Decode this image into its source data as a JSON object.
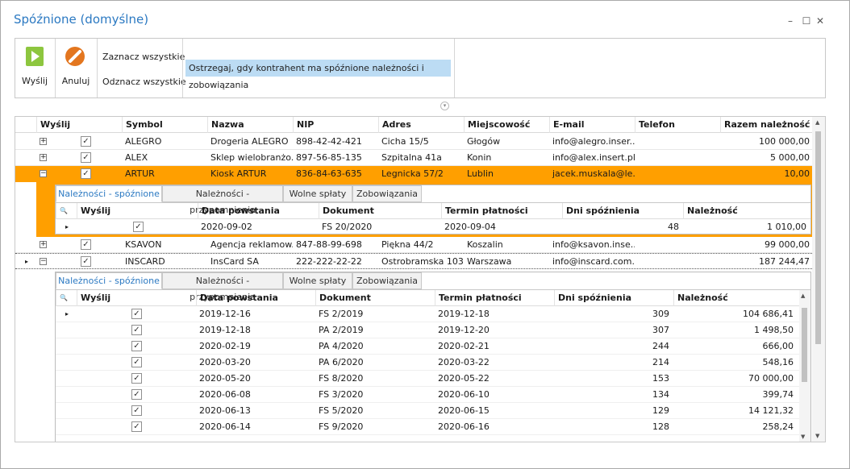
{
  "window": {
    "title": "Spóźnione (domyślne)",
    "min_glyph": "–",
    "max_glyph": "☐",
    "close_glyph": "✕"
  },
  "toolbar": {
    "send_label": "Wyślij",
    "cancel_label": "Anuluj",
    "select_all": "Zaznacz wszystkie",
    "deselect_all": "Odznacz wszystkie",
    "warn_option": "Ostrzegaj, gdy kontrahent ma spóźnione należności i zobowiązania"
  },
  "grid": {
    "columns": [
      "Wyślij",
      "Symbol",
      "Nazwa",
      "NIP",
      "Adres",
      "Miejscowość",
      "E-mail",
      "Telefon",
      "Razem należność"
    ],
    "rows": [
      {
        "symbol": "ALEGRO",
        "nazwa": "Drogeria ALEGRO",
        "nip": "898-42-42-421",
        "adres": "Cicha  15/5",
        "miejscowosc": "Głogów",
        "email": "info@alegro.inser...",
        "telefon": "",
        "razem": "100 000,00"
      },
      {
        "symbol": "ALEX",
        "nazwa": "Sklep wielobranżo...",
        "nip": "897-56-85-135",
        "adres": "Szpitalna  41a",
        "miejscowosc": "Konin",
        "email": "info@alex.insert.pl",
        "telefon": "",
        "razem": "5 000,00"
      },
      {
        "symbol": "ARTUR",
        "nazwa": "Kiosk ARTUR",
        "nip": "836-84-63-635",
        "adres": "Legnicka  57/2",
        "miejscowosc": "Lublin",
        "email": "jacek.muskala@le...",
        "telefon": "",
        "razem": "10,00"
      },
      {
        "symbol": "KSAVON",
        "nazwa": "Agencja reklamow...",
        "nip": "847-88-99-698",
        "adres": "Piękna  44/2",
        "miejscowosc": "Koszalin",
        "email": "info@ksavon.inse...",
        "telefon": "",
        "razem": "99 000,00"
      },
      {
        "symbol": "INSCARD",
        "nazwa": "InsCard SA",
        "nip": "222-222-22-22",
        "adres": "Ostrobramska  103",
        "miejscowosc": "Warszawa",
        "email": "info@inscard.com.pl",
        "telefon": "",
        "razem": "187 244,47"
      }
    ]
  },
  "detail": {
    "tabs": [
      "Należności - spóźnione",
      "Należności - przypomnienia",
      "Wolne spłaty",
      "Zobowiązania"
    ],
    "columns": [
      "Wyślij",
      "Data powstania",
      "Dokument",
      "Termin płatności",
      "Dni spóźnienia",
      "Należność"
    ],
    "artur_rows": [
      {
        "data": "2020-09-02",
        "dok": "FS 20/2020",
        "termin": "2020-09-04",
        "dni": "48",
        "naleznosc": "1 010,00"
      }
    ],
    "inscard_rows": [
      {
        "data": "2019-12-16",
        "dok": "FS 2/2019",
        "termin": "2019-12-18",
        "dni": "309",
        "naleznosc": "104 686,41"
      },
      {
        "data": "2019-12-18",
        "dok": "PA 2/2019",
        "termin": "2019-12-20",
        "dni": "307",
        "naleznosc": "1 498,50"
      },
      {
        "data": "2020-02-19",
        "dok": "PA 4/2020",
        "termin": "2020-02-21",
        "dni": "244",
        "naleznosc": "666,00"
      },
      {
        "data": "2020-03-20",
        "dok": "PA 6/2020",
        "termin": "2020-03-22",
        "dni": "214",
        "naleznosc": "548,16"
      },
      {
        "data": "2020-05-20",
        "dok": "FS 8/2020",
        "termin": "2020-05-22",
        "dni": "153",
        "naleznosc": "70 000,00"
      },
      {
        "data": "2020-06-08",
        "dok": "FS 3/2020",
        "termin": "2020-06-10",
        "dni": "134",
        "naleznosc": "399,74"
      },
      {
        "data": "2020-06-13",
        "dok": "FS 5/2020",
        "termin": "2020-06-15",
        "dni": "129",
        "naleznosc": "14 121,32"
      },
      {
        "data": "2020-06-14",
        "dok": "FS 9/2020",
        "termin": "2020-06-16",
        "dni": "128",
        "naleznosc": "258,24"
      }
    ]
  },
  "colors": {
    "accent": "#2b79c2",
    "selected_row": "#ff9f00",
    "warn_chip": "#bcdcf4"
  },
  "glyphs": {
    "check": "✓",
    "expand": "+",
    "collapse": "−",
    "row_indicator": "▸",
    "search": "🔍"
  }
}
